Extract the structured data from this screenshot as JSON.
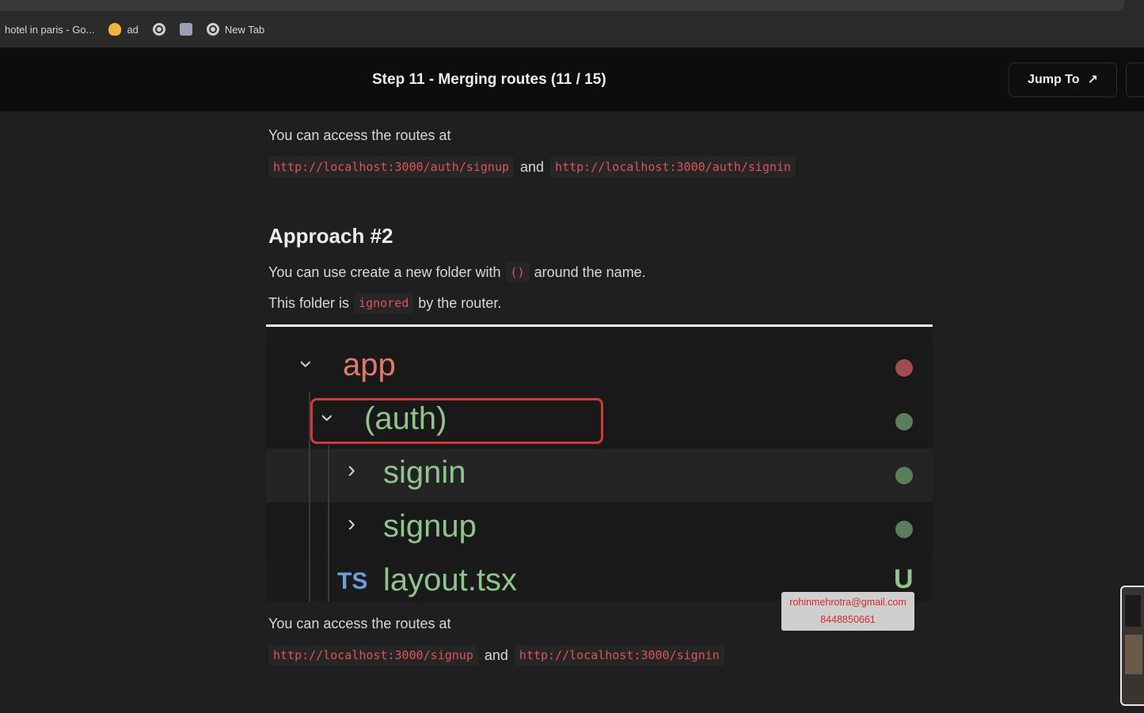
{
  "bookmarks": {
    "items": [
      {
        "label": "hotel in paris - Go...",
        "icon": "google-icon"
      },
      {
        "label": "ad",
        "icon": "flame-icon"
      },
      {
        "label": "",
        "icon": "globe-icon"
      },
      {
        "label": "",
        "icon": "gear-icon"
      },
      {
        "label": "New Tab",
        "icon": "globe-icon"
      }
    ]
  },
  "header": {
    "title": "Step 11 - Merging routes (11 / 15)",
    "jump_label": "Jump To",
    "jump_arrow": "↗"
  },
  "content": {
    "intro_text": "You can access the routes at",
    "route_signup_1": "http://localhost:3000/auth/signup",
    "and_1": "and",
    "route_signin_1": "http://localhost:3000/auth/signin",
    "approach_title": "Approach #2",
    "line3_before": "You can use create a new folder with",
    "line3_code": "()",
    "line3_after": "around the name.",
    "line4_before": "This folder is",
    "line4_code": "ignored",
    "line4_after": "by the router.",
    "outro_text": "You can access the routes at",
    "route_signup_2": "http://localhost:3000/signup",
    "and_2": "and",
    "route_signin_2": "http://localhost:3000/signin"
  },
  "tree": {
    "app": "app",
    "auth": "(auth)",
    "signin": "signin",
    "signup": "signup",
    "layout": "layout.tsx",
    "ts_badge": "TS",
    "u_badge": "U"
  },
  "watermark": {
    "email": "rohinmehrotra@gmail.com",
    "phone": "8448850661"
  },
  "colors": {
    "code_text": "#e0525a",
    "folder_green": "#8fc48c",
    "app_red": "#e07a6a",
    "highlight_border": "#d23a3a"
  }
}
